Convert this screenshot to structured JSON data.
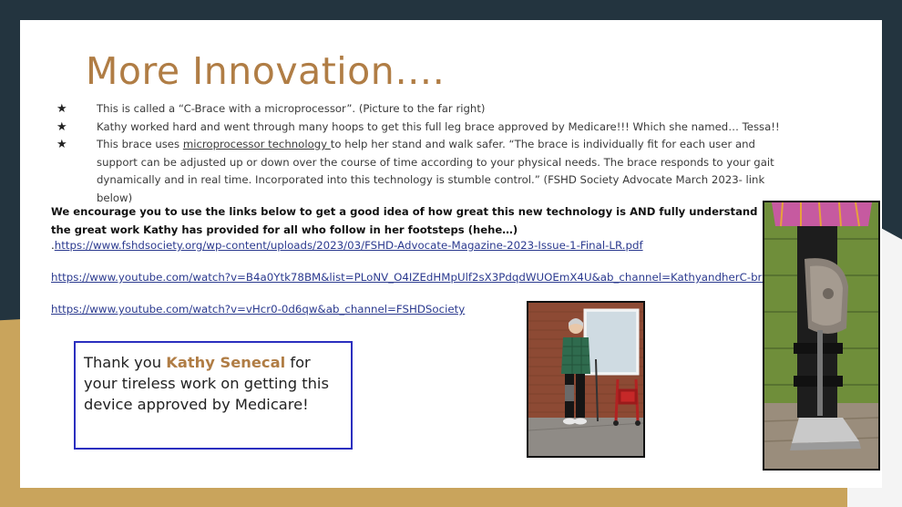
{
  "slide": {
    "title": "More Innovation….",
    "bullets": [
      "This is called a “C-Brace with a microprocessor”. (Picture to the far right)",
      "Kathy worked hard and went through many hoops to get this full leg brace approved by Medicare!!! Which she named… Tessa!!",
      {
        "before": "This brace uses ",
        "underlined": "microprocessor technology ",
        "after": "to help her stand and walk safer. “The brace is individually fit for each user and support can be adjusted up or down over the course of time according to your physical needs. The brace responds to your gait dynamically and in real time. Incorporated into this technology is stumble control.” (FSHD Society Advocate March 2023- link below)"
      }
    ],
    "encourage_text": "We encourage you to use the links below to get a good idea of how great this new technology is AND fully understand the great work Kathy has provided for all who follow in her footsteps (hehe…)",
    "link_prefix": ".",
    "links": [
      "https://www.fshdsociety.org/wp-content/uploads/2023/03/FSHD-Advocate-Magazine-2023-Issue-1-Final-LR.pdf",
      "https://www.youtube.com/watch?v=B4a0Ytk78BM&list=PLoNV_O4IZEdHMpUlf2sX3PdqdWUOEmX4U&ab_channel=KathyandherC-brace",
      "https://www.youtube.com/watch?v=vHcr0-0d6qw&ab_channel=FSHDSociety"
    ],
    "thank_you": {
      "before": "Thank you ",
      "name": "Kathy Senecal",
      "after": " for your tireless work on getting this device approved by Medicare!"
    }
  },
  "colors": {
    "title": "#b07d45",
    "link": "#2b3a8f",
    "box_border": "#2b2fbf",
    "background_dark": "#23343f",
    "background_gold": "#c9a45c"
  },
  "icons": {
    "bullet": "star-icon"
  }
}
